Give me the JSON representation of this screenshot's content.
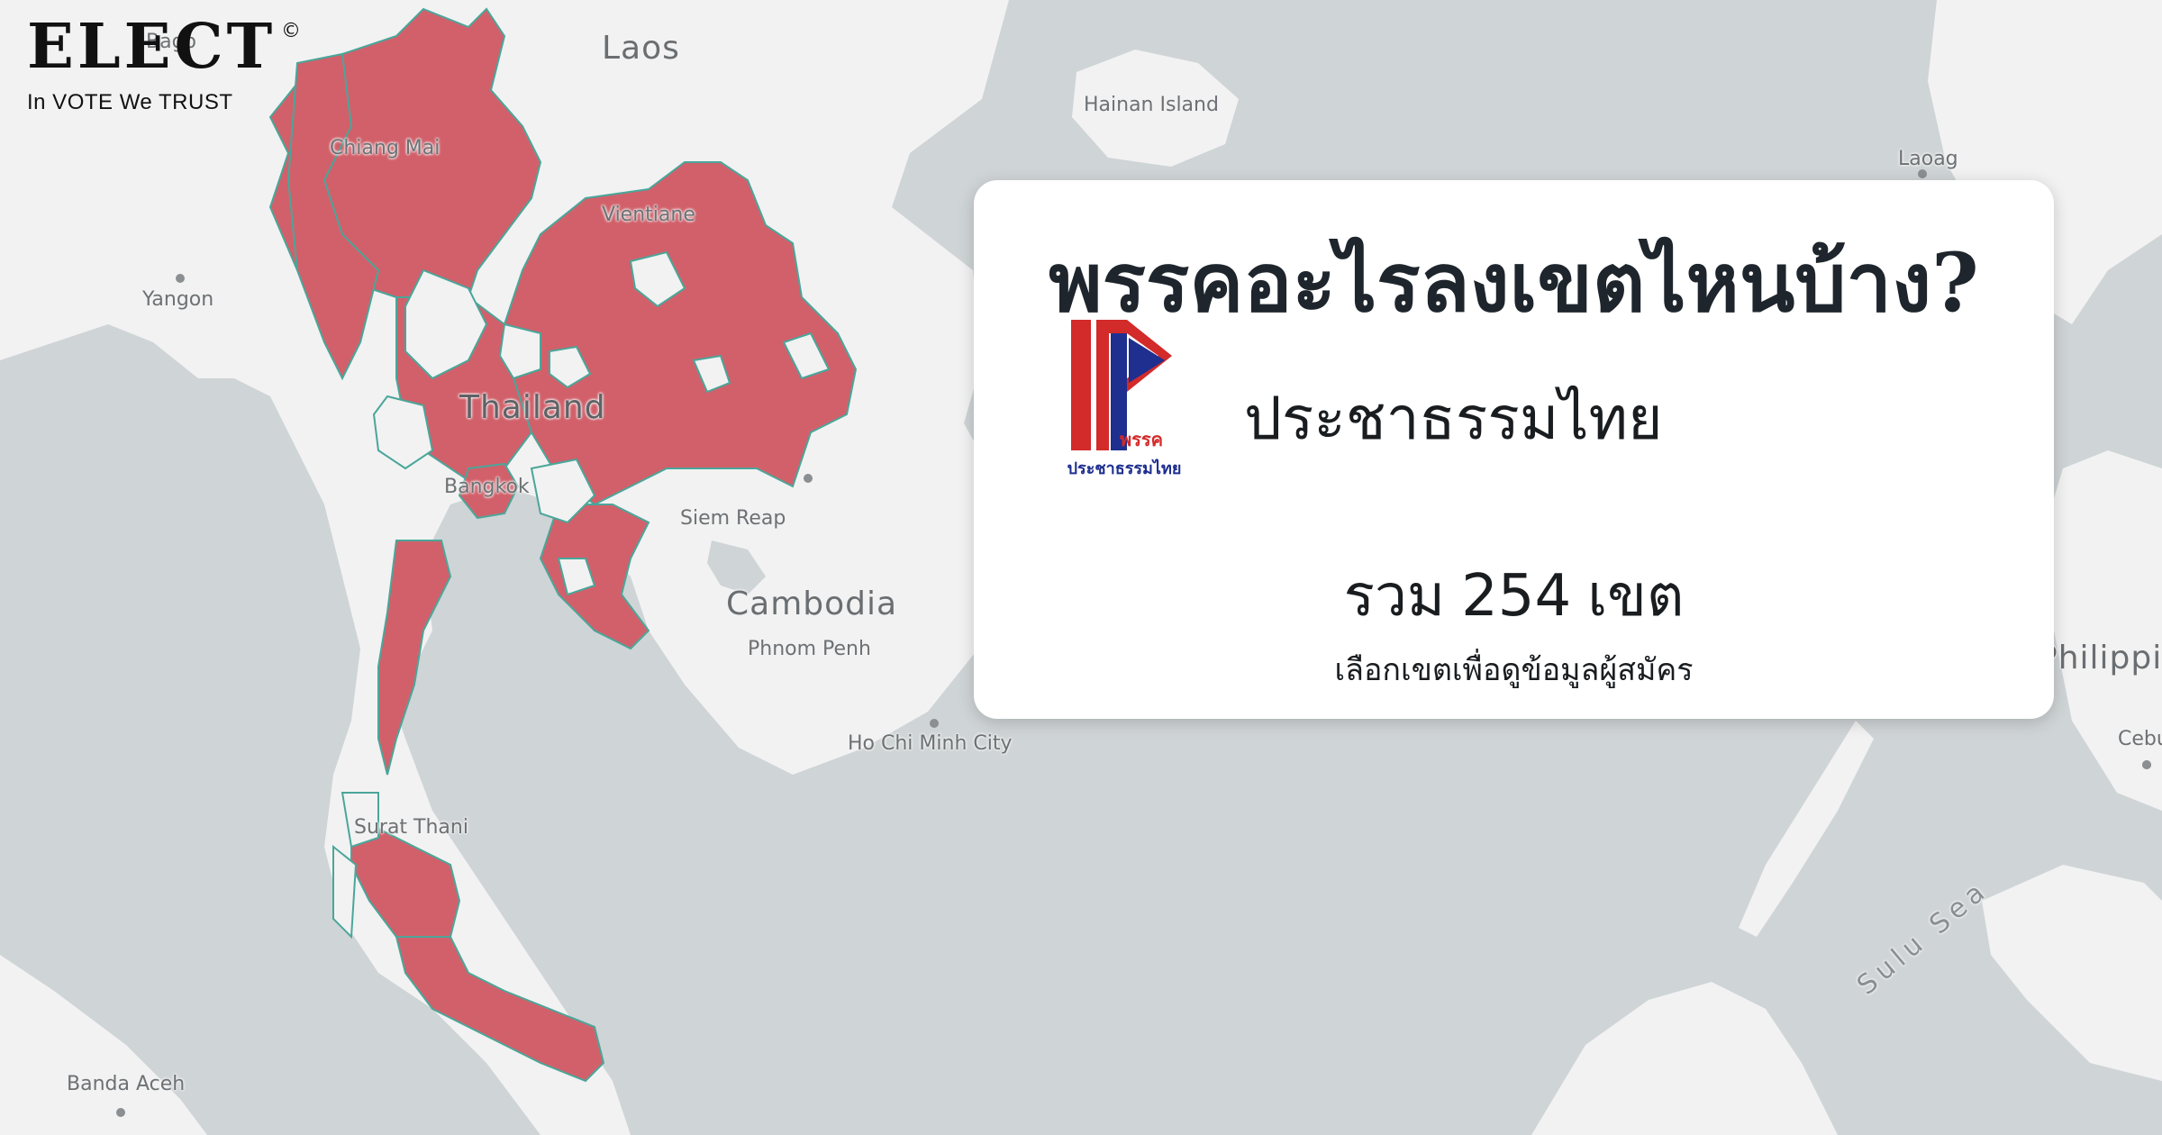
{
  "brand": {
    "name": "ELECT",
    "copyright": "©",
    "tagline": "In VOTE We TRUST"
  },
  "map": {
    "colors": {
      "water": "#cfd4d6",
      "land": "#f2f2f2",
      "highlight": "#d2606a",
      "border": "#4aa69a"
    },
    "labels": {
      "laos": "Laos",
      "hainan": "Hainan Island",
      "laoag": "Laoag",
      "yangon": "Yangon",
      "thailand": "Thailand",
      "bangkok": "Bangkok",
      "chiang_mai": "Chiang Mai",
      "vientiane": "Vientiane",
      "siem_reap": "Siem Reap",
      "cambodia": "Cambodia",
      "phnom_penh": "Phnom Penh",
      "ho_chi_minh": "Ho Chi Minh City",
      "philippines": "Philippines",
      "cebu": "Cebu",
      "sulu_sea": "Sulu Sea",
      "surat_thani": "Surat Thani",
      "banda_aceh": "Banda Aceh",
      "bago": "Bago"
    }
  },
  "card": {
    "title": "พรรคอะไรลงเขตไหนบ้าง?",
    "party_name": "ประชาธรรมไทย",
    "logo_text_top": "พรรค",
    "logo_text_bottom": "ประชาธรรมไทย",
    "total_prefix": "รวม",
    "total_count": "254",
    "total_suffix": "เขต",
    "hint": "เลือกเขตเพื่อดูข้อมูลผู้สมัคร"
  }
}
